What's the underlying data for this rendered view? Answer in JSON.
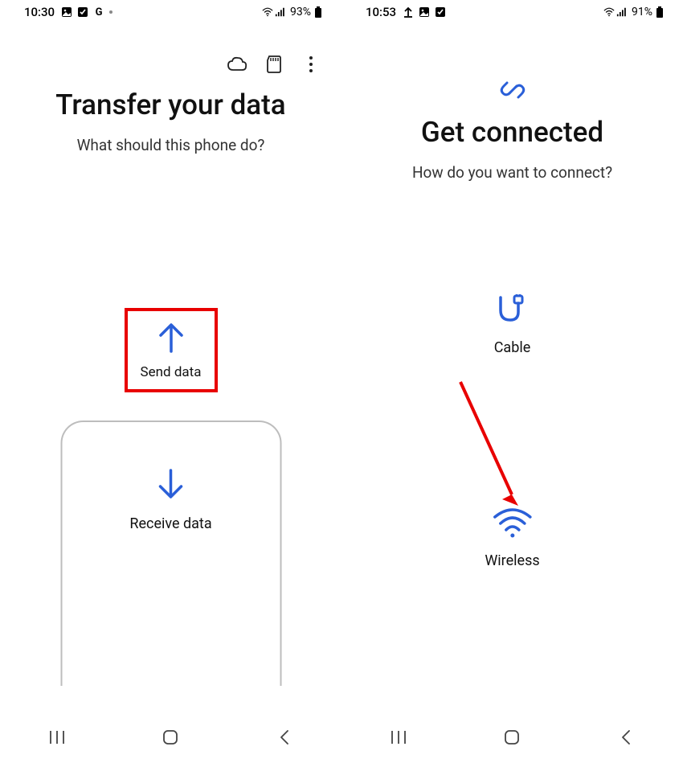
{
  "left": {
    "status": {
      "time": "10:30",
      "battery": "93%"
    },
    "title": "Transfer your data",
    "subtitle": "What should this phone do?",
    "send_label": "Send data",
    "receive_label": "Receive data"
  },
  "right": {
    "status": {
      "time": "10:53",
      "battery": "91%"
    },
    "title": "Get connected",
    "subtitle": "How do you want to connect?",
    "cable_label": "Cable",
    "wireless_label": "Wireless"
  },
  "colors": {
    "accent": "#2a5fd8",
    "highlight": "#e80000"
  }
}
